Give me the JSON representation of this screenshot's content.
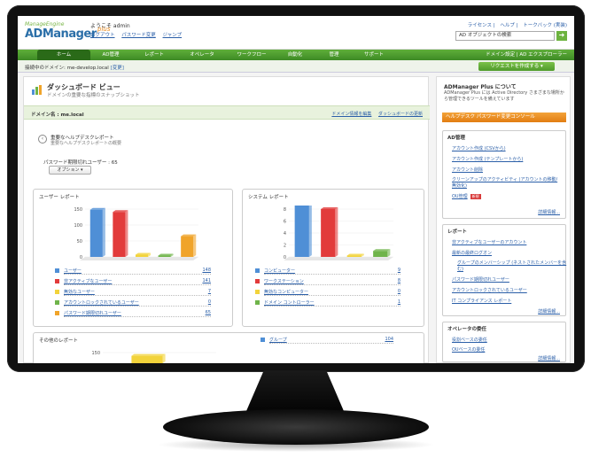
{
  "app": {
    "logo_small": "ManageEngine",
    "logo_big": "ADManager",
    "logo_plus": "plus",
    "welcome": "ようこそ admin",
    "top_links": [
      "ログアウト",
      "パスワード変更",
      "ジャンプ"
    ],
    "right_links": [
      "ライセンス",
      "ヘルプ",
      "トークバック (実装)"
    ],
    "search_placeholder": "AD オブジェクトの検索",
    "search_go": "➜"
  },
  "nav": {
    "tabs": [
      "ホーム",
      "AD管理",
      "レポート",
      "オペレータ",
      "ワークフロー",
      "自動化",
      "管理",
      "サポート"
    ],
    "right": "ドメイン設定 | AD エクスプローラー"
  },
  "domainbar": {
    "text": "接続中のドメイン: me-develop.local",
    "change": "[変更]",
    "request_btn": "リクエストを作成する"
  },
  "dashboard": {
    "title": "ダッシュボード ビュー",
    "subtitle": "ドメインの重要な指標のスナップショット",
    "domain_name": "ドメイン名 : me.local",
    "edit_link": "ドメイン情報を編集",
    "update_link": "ダッシュボードの更新",
    "helpdesk_title": "重要なヘルプデスクレポート",
    "helpdesk_sub": "重要なヘルプデスクレポートの概要",
    "pwd_label": "パスワード期限切れユーザー : 65",
    "option_btn": "オプション"
  },
  "user_report": {
    "title": "ユーザー レポート",
    "legend": [
      {
        "label": "ユーザー",
        "value": "148",
        "color": "#4f8fd6"
      },
      {
        "label": "非アクティブなユーザー",
        "value": "141",
        "color": "#e23b3b"
      },
      {
        "label": "無効なユーザー",
        "value": "7",
        "color": "#f2d33b"
      },
      {
        "label": "アカウントロックされているユーザー",
        "value": "0",
        "color": "#6fb44a"
      },
      {
        "label": "パスワード期限切れユーザー",
        "value": "65",
        "color": "#f0a42a"
      }
    ]
  },
  "system_report": {
    "title": "システム レポート",
    "legend": [
      {
        "label": "コンピューター",
        "value": "9",
        "color": "#4f8fd6"
      },
      {
        "label": "ワークステーション",
        "value": "8",
        "color": "#e23b3b"
      },
      {
        "label": "無効なコンピューター",
        "value": "0",
        "color": "#f2d33b"
      },
      {
        "label": "ドメイン コントローラー",
        "value": "1",
        "color": "#6fb44a"
      }
    ]
  },
  "other_report": {
    "title": "その他のレポート",
    "legend": [
      {
        "label": "グループ",
        "value": "104",
        "color": "#4f8fd6"
      }
    ]
  },
  "chart_data": [
    {
      "type": "bar",
      "categories": [
        "ユーザー",
        "非アクティブなユーザー",
        "無効なユーザー",
        "アカウントロックされているユーザー",
        "パスワード期限切れユーザー"
      ],
      "values": [
        148,
        141,
        7,
        0,
        65
      ],
      "ylim": [
        0,
        150
      ],
      "yticks": [
        "150",
        "100",
        "50",
        "0"
      ]
    },
    {
      "type": "bar",
      "categories": [
        "コンピューター",
        "ワークステーション",
        "無効なコンピューター",
        "ドメイン コントローラー"
      ],
      "values": [
        9,
        8,
        0,
        1
      ],
      "ylim": [
        0,
        8
      ],
      "yticks": [
        "8",
        "6",
        "4",
        "2",
        "0"
      ]
    },
    {
      "type": "bar",
      "categories": [
        "グループ"
      ],
      "values": [
        104
      ],
      "ylim": [
        0,
        150
      ],
      "yticks": [
        "150"
      ]
    }
  ],
  "side": {
    "title": "ADManager Plus について",
    "desc": "ADManager Plus には Active Directory さまざまな場所から管理できるツールを備えています",
    "orange_link": "ヘルプデスク パスワード変更コンソール",
    "ad_box": {
      "title": "AD管理",
      "items": [
        "アカウント作成 (CSVから)",
        "アカウント作成 (テンプレートから)",
        "アカウント削除",
        "クリーンアップのアクティビティ (アカウントの移動/無効化)",
        "OU管理"
      ],
      "badge": "新規",
      "more": "詳細情報..."
    },
    "report_box": {
      "title": "レポート",
      "items": [
        "非アクティブなユーザーのアカウント",
        "最新の最終ログオン",
        "グループのメンバーシップ (ネストされたメンバーを含む)",
        "パスワード期限切れユーザー",
        "アカウントロックされているユーザー",
        "IT コンプライアンス レポート"
      ],
      "more": "詳細情報..."
    },
    "op_box": {
      "title": "オペレータの委任",
      "items": [
        "役割ベースの委任",
        "OUベースの委任"
      ],
      "more": "詳細情報..."
    }
  }
}
